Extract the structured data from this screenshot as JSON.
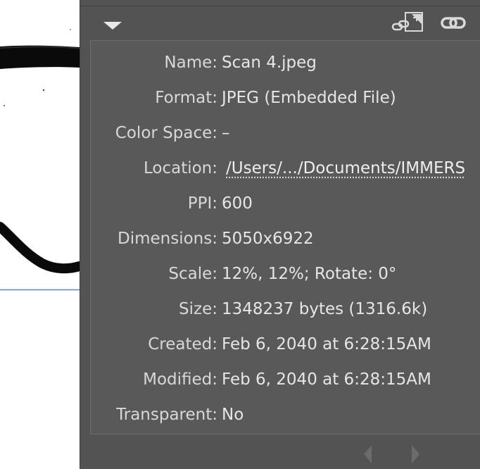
{
  "panel": {
    "collapse_icon": "triangle-down-icon",
    "relink_icon": "relink-embedded-icon",
    "link_icon": "link-chain-icon"
  },
  "info": {
    "rows": [
      {
        "label": "Name:",
        "value": "Scan 4.jpeg"
      },
      {
        "label": "Format:",
        "value": "JPEG (Embedded File)"
      },
      {
        "label": "Color Space:",
        "value": "–"
      },
      {
        "label": "Location:",
        "value": "/Users/.../Documents/IMMERS"
      },
      {
        "label": "PPI:",
        "value": "600"
      },
      {
        "label": "Dimensions:",
        "value": "5050x6922"
      },
      {
        "label": "Scale:",
        "value": "12%, 12%; Rotate: 0°"
      },
      {
        "label": "Size:",
        "value": "1348237 bytes (1316.6k)"
      },
      {
        "label": "Created:",
        "value": "Feb 6, 2040 at 6:28:15AM"
      },
      {
        "label": "Modified:",
        "value": "Feb 6, 2040 at 6:28:15AM"
      },
      {
        "label": "Transparent:",
        "value": "No"
      }
    ]
  },
  "navigation": {
    "prev_icon": "arrow-left-icon",
    "next_icon": "arrow-right-icon"
  },
  "colors": {
    "panel_bg": "#535353",
    "info_bg": "#595959",
    "label_text": "#d8d8d8",
    "selection_line": "#5b86d6"
  }
}
